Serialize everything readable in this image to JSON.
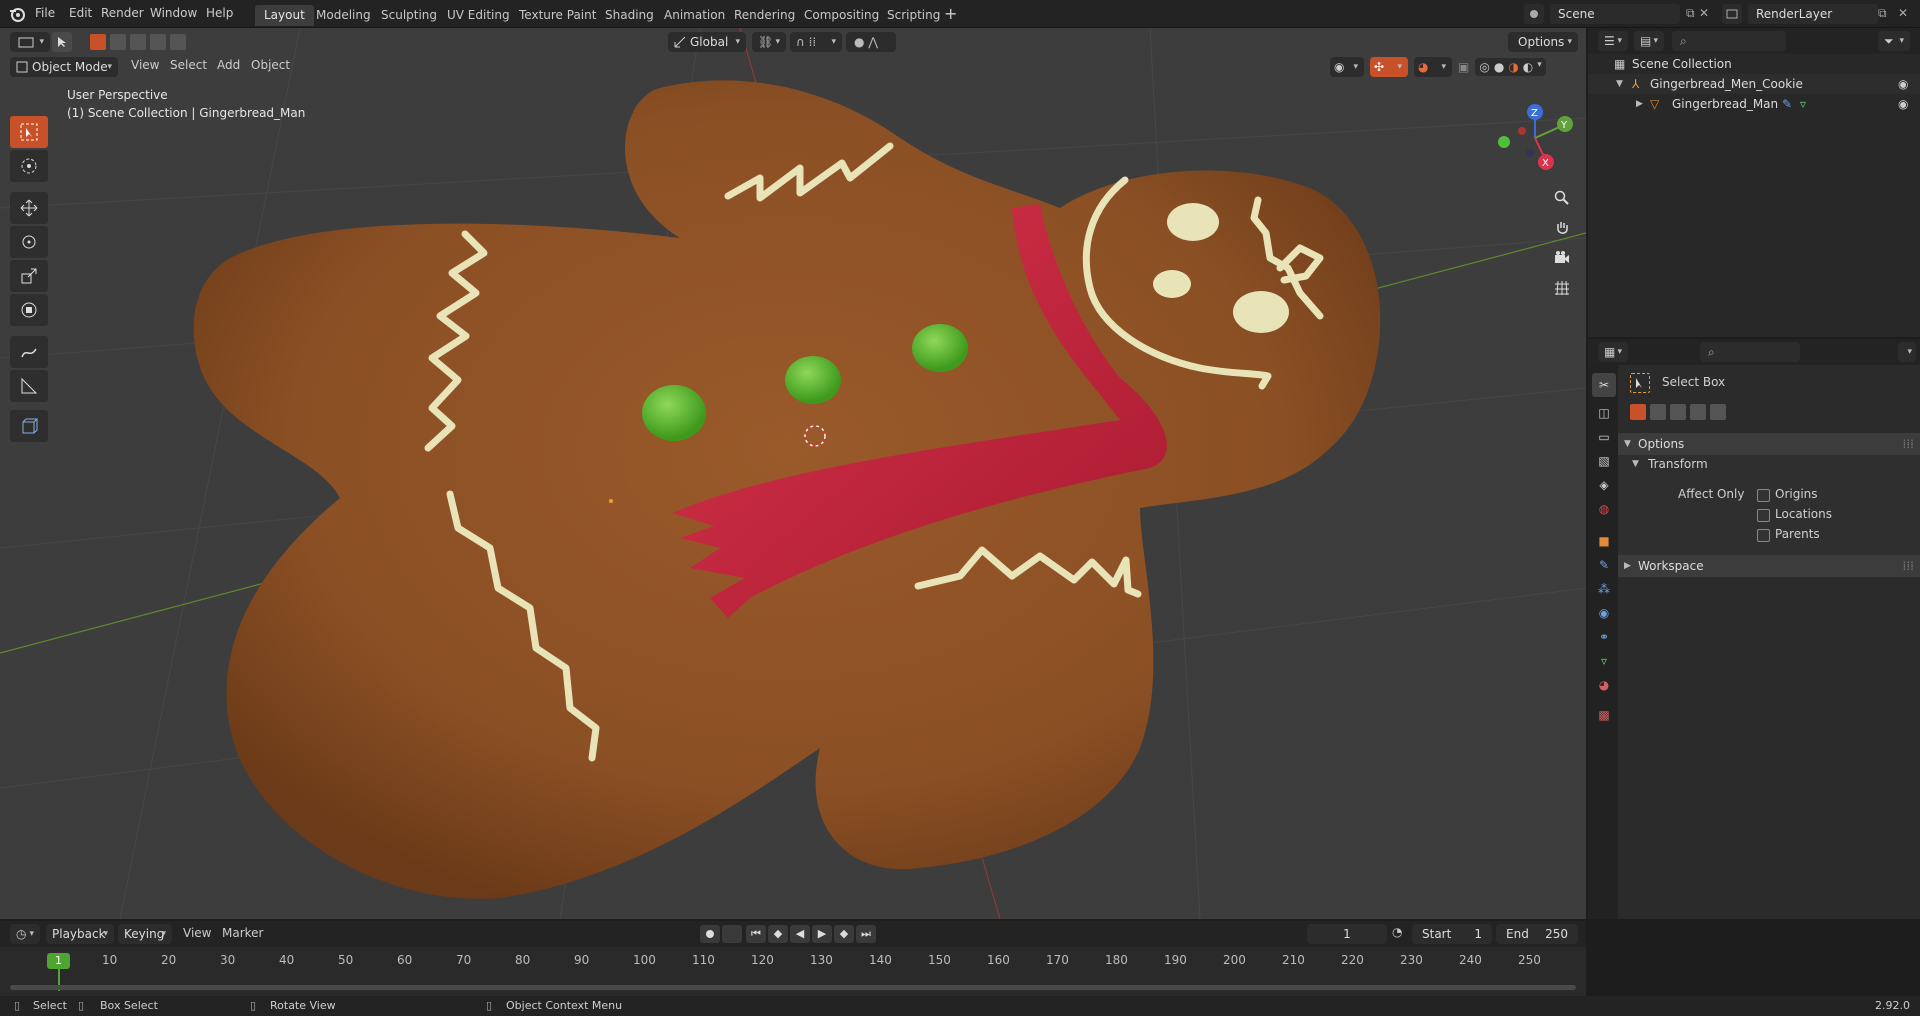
{
  "menus": [
    "File",
    "Edit",
    "Render",
    "Window",
    "Help"
  ],
  "workspaces": [
    "Layout",
    "Modeling",
    "Sculpting",
    "UV Editing",
    "Texture Paint",
    "Shading",
    "Animation",
    "Rendering",
    "Compositing",
    "Scripting"
  ],
  "scene": "Scene",
  "render_layer": "RenderLayer",
  "viewport": {
    "mode": "Object Mode",
    "menu": [
      "View",
      "Select",
      "Add",
      "Object"
    ],
    "orientation": "Global",
    "options_label": "Options",
    "perspective": "User Perspective",
    "collection_info": "(1) Scene Collection | Gingerbread_Man",
    "gizmo": {
      "z": "Z",
      "y": "Y",
      "x": "X"
    }
  },
  "outliner": {
    "root": "Scene Collection",
    "collection": "Gingerbread_Men_Cookie",
    "object": "Gingerbread_Man"
  },
  "properties": {
    "tool_name": "Select Box",
    "options": "Options",
    "transform": "Transform",
    "affect_only": "Affect Only",
    "origins": "Origins",
    "locations": "Locations",
    "parents": "Parents",
    "workspace": "Workspace"
  },
  "timeline": {
    "playback": "Playback",
    "keying": "Keying",
    "view": "View",
    "marker": "Marker",
    "current_frame": "1",
    "start_label": "Start",
    "start": "1",
    "end_label": "End",
    "end": "250",
    "ticks": [
      "10",
      "20",
      "30",
      "40",
      "50",
      "60",
      "70",
      "80",
      "90",
      "100",
      "110",
      "120",
      "130",
      "140",
      "150",
      "160",
      "170",
      "180",
      "190",
      "200",
      "210",
      "220",
      "230",
      "240",
      "250"
    ]
  },
  "status": {
    "select": "Select",
    "box_select": "Box Select",
    "rotate_view": "Rotate View",
    "context_menu": "Object Context Menu",
    "version": "2.92.0"
  },
  "colors": {
    "accent": "#c8512a",
    "cookie": "#8a4f24",
    "icing": "#e8e4b8",
    "scarf": "#c8243c",
    "button": "#5fb52f"
  }
}
